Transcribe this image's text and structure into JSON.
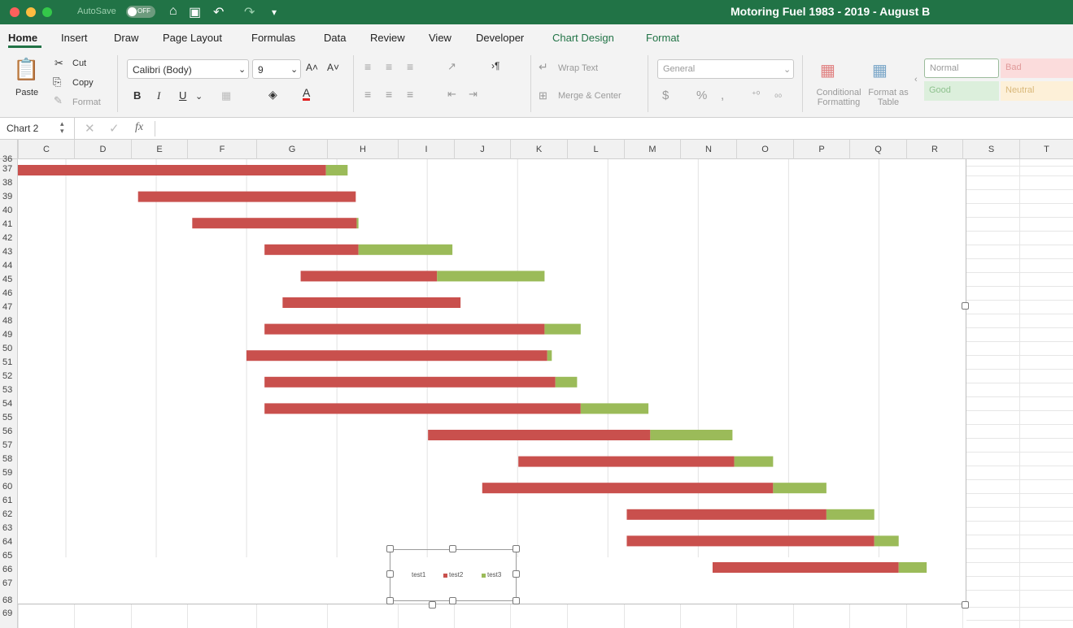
{
  "titlebar": {
    "autosave_label": "AutoSave",
    "autosave_state": "OFF",
    "doc_title": "Motoring Fuel 1983 - 2019 - August B"
  },
  "tabs": [
    "Home",
    "Insert",
    "Draw",
    "Page Layout",
    "Formulas",
    "Data",
    "Review",
    "View",
    "Developer",
    "Chart Design",
    "Format"
  ],
  "ribbon": {
    "paste": "Paste",
    "cut": "Cut",
    "copy": "Copy",
    "format_painter": "Format",
    "font_name": "Calibri (Body)",
    "font_size": "9",
    "bold": "B",
    "italic": "I",
    "underline": "U",
    "wrap_text": "Wrap Text",
    "merge_center": "Merge & Center",
    "number_format": "General",
    "conditional_formatting": "Conditional Formatting",
    "format_as_table": "Format as Table",
    "styles": {
      "normal": "Normal",
      "bad": "Bad",
      "good": "Good",
      "neutral": "Neutral"
    }
  },
  "formula_bar": {
    "name_box": "Chart 2",
    "fx": "fx"
  },
  "columns": [
    "C",
    "D",
    "E",
    "F",
    "G",
    "H",
    "I",
    "J",
    "K",
    "L",
    "M",
    "N",
    "O",
    "P",
    "Q",
    "R",
    "S",
    "T"
  ],
  "rows": [
    "36",
    "37",
    "38",
    "39",
    "40",
    "41",
    "42",
    "43",
    "44",
    "45",
    "46",
    "47",
    "48",
    "49",
    "50",
    "51",
    "52",
    "53",
    "54",
    "55",
    "56",
    "57",
    "58",
    "59",
    "60",
    "61",
    "62",
    "63",
    "64",
    "65",
    "66",
    "67",
    "68",
    "69"
  ],
  "chart_data": {
    "type": "bar",
    "stacked": true,
    "orientation": "horizontal",
    "series": [
      {
        "name": "test1",
        "color": "none",
        "values": [
          0,
          133,
          193,
          273,
          313,
          293,
          273,
          253,
          273,
          273,
          454,
          554,
          514,
          674,
          674,
          769
        ]
      },
      {
        "name": "test2",
        "color": "#c9504d",
        "values": [
          341,
          241,
          182,
          104,
          151,
          197,
          310,
          333,
          322,
          350,
          246,
          239,
          322,
          221,
          274,
          206
        ]
      },
      {
        "name": "test3",
        "color": "#9bbb59",
        "values": [
          24,
          0,
          2,
          104,
          119,
          0,
          40,
          5,
          24,
          75,
          91,
          43,
          59,
          53,
          27,
          31
        ]
      }
    ],
    "xlim": [
      0,
      1050
    ],
    "grid": true,
    "legend": "bottom"
  }
}
